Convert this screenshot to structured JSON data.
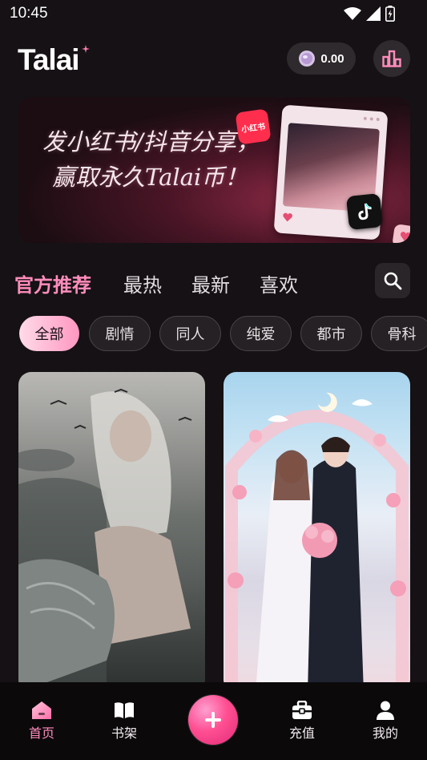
{
  "status": {
    "time": "10:45"
  },
  "header": {
    "logo": "Talai",
    "coin_balance": "0.00"
  },
  "banner": {
    "line1": "发小红书/抖音分享，",
    "line2": "赢取永久Talai币！",
    "xhs_badge": "小红书"
  },
  "tabs": [
    {
      "label": "官方推荐",
      "active": true
    },
    {
      "label": "最热"
    },
    {
      "label": "最新"
    },
    {
      "label": "喜欢"
    }
  ],
  "chips": [
    {
      "label": "全部",
      "active": true
    },
    {
      "label": "剧情"
    },
    {
      "label": "同人"
    },
    {
      "label": "纯爱"
    },
    {
      "label": "都市"
    },
    {
      "label": "骨科"
    }
  ],
  "bottom_nav": {
    "home": "首页",
    "shelf": "书架",
    "recharge": "充值",
    "profile": "我的"
  },
  "colors": {
    "accent": "#ff8cbc",
    "background": "#151114"
  }
}
